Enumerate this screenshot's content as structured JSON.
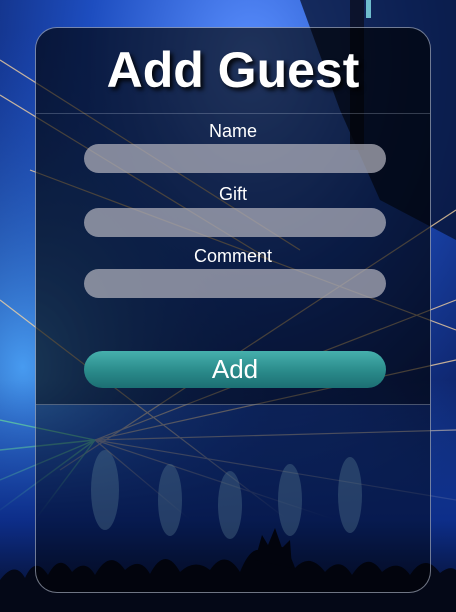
{
  "form": {
    "title": "Add Guest",
    "fields": [
      {
        "label": "Name",
        "value": "",
        "placeholder": ""
      },
      {
        "label": "Gift",
        "value": "",
        "placeholder": ""
      },
      {
        "label": "Comment",
        "value": "",
        "placeholder": ""
      }
    ],
    "submit_label": "Add"
  },
  "background": {
    "image": "concert-laser-light-show",
    "colors": {
      "sky": "#1a4fb0",
      "deep": "#06102e",
      "laser": "#ffd9a0",
      "green_laser": "#7dff9a"
    }
  },
  "colors": {
    "button_accent": "#2a8a8a",
    "input_fill": "#b2b2bc",
    "text": "#ffffff"
  }
}
